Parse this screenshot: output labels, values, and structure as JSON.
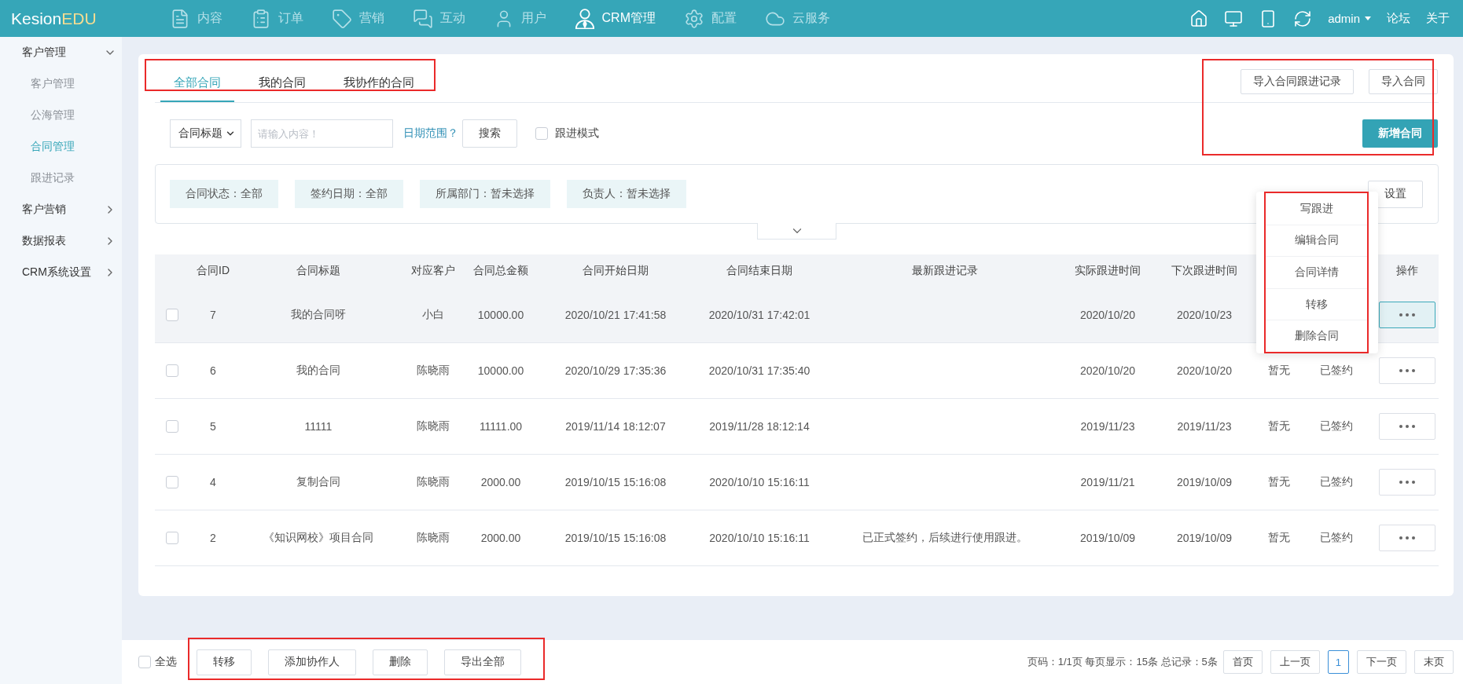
{
  "header": {
    "logo": {
      "brand": "Kesion",
      "accent": "EDU"
    },
    "nav": [
      {
        "label": "内容",
        "selected": false
      },
      {
        "label": "订单",
        "selected": false
      },
      {
        "label": "营销",
        "selected": false
      },
      {
        "label": "互动",
        "selected": false
      },
      {
        "label": "用户",
        "selected": false
      },
      {
        "label": "CRM管理",
        "selected": true
      },
      {
        "label": "配置",
        "selected": false
      },
      {
        "label": "云服务",
        "selected": false
      }
    ],
    "user": "admin",
    "links": [
      "论坛",
      "关于"
    ]
  },
  "sidebar": {
    "items": [
      {
        "label": "客户管理",
        "expanded": true,
        "children": [
          {
            "label": "客户管理",
            "selected": false
          },
          {
            "label": "公海管理",
            "selected": false
          },
          {
            "label": "合同管理",
            "selected": true
          },
          {
            "label": "跟进记录",
            "selected": false
          }
        ]
      },
      {
        "label": "客户营销",
        "expanded": false
      },
      {
        "label": "数据报表",
        "expanded": false
      },
      {
        "label": "CRM系统设置",
        "expanded": false
      }
    ]
  },
  "tab_bar": {
    "annotated": true,
    "tabs": [
      {
        "label": "全部合同",
        "selected": true
      },
      {
        "label": "我的合同",
        "selected": false
      },
      {
        "label": "我协作的合同",
        "selected": false
      }
    ]
  },
  "actions": {
    "annotated": true,
    "secondary": [
      "导入合同跟进记录",
      "导入合同"
    ],
    "primary": "新增合同"
  },
  "search": {
    "field": "合同标题",
    "placeholder": "请输入内容！",
    "date_range": "日期范围？",
    "button": "搜索",
    "follow_mode": {
      "label": "跟进模式",
      "checked": false
    }
  },
  "filters": {
    "chips": [
      "合同状态：全部",
      "签约日期：全部",
      "所属部门：暂未选择",
      "负责人：暂未选择"
    ],
    "settings": "设置",
    "expanded": false
  },
  "table": {
    "columns": [
      "合同ID",
      "合同标题",
      "对应客户",
      "合同总金额",
      "合同开始日期",
      "合同结束日期",
      "最新跟进记录",
      "实际跟进时间",
      "下次跟进时间",
      null,
      null,
      "操作"
    ],
    "rows": [
      {
        "checked": false,
        "selected": true,
        "menu_open": true,
        "id": "7",
        "title": "我的合同呀",
        "customer": "小白",
        "amount": "10000.00",
        "start": "2020/10/21 17:41:58",
        "end": "2020/10/31 17:42:01",
        "actual": "2020/10/20",
        "next": "2020/10/23"
      },
      {
        "checked": false,
        "selected": false,
        "menu_open": false,
        "id": "6",
        "title": "我的合同",
        "customer": "陈晓雨",
        "amount": "10000.00",
        "start": "2020/10/29 17:35:36",
        "end": "2020/10/31 17:35:40",
        "actual": "2020/10/20",
        "next": "2020/10/20",
        "column_10": "暂无",
        "column_11": "已签约"
      },
      {
        "checked": false,
        "selected": false,
        "menu_open": false,
        "id": "5",
        "title": "11111",
        "customer": "陈晓雨",
        "amount": "11111.00",
        "start": "2019/11/14 18:12:07",
        "end": "2019/11/28 18:12:14",
        "actual": "2019/11/23",
        "next": "2019/11/23",
        "column_10": "暂无",
        "column_11": "已签约"
      },
      {
        "checked": false,
        "selected": false,
        "menu_open": false,
        "id": "4",
        "title": "复制合同",
        "customer": "陈晓雨",
        "amount": "2000.00",
        "start": "2019/10/15 15:16:08",
        "end": "2020/10/10 15:16:11",
        "actual": "2019/11/21",
        "next": "2019/10/09",
        "column_10": "暂无",
        "column_11": "已签约"
      },
      {
        "checked": false,
        "selected": false,
        "menu_open": false,
        "id": "2",
        "title": "《知识网校》项目合同",
        "customer": "陈晓雨",
        "amount": "2000.00",
        "start": "2019/10/15 15:16:08",
        "end": "2020/10/10 15:16:11",
        "latest": "已正式签约，后续进行使用跟进。",
        "actual": "2019/10/09",
        "next": "2019/10/09",
        "column_10": "暂无",
        "column_11": "已签约"
      }
    ],
    "row_menu": {
      "annotated": true,
      "items": [
        "写跟进",
        "编辑合同",
        "合同详情",
        "转移",
        "删除合同"
      ]
    }
  },
  "bulk_bar": {
    "select_all": {
      "label": "全选",
      "checked": false
    },
    "annotated": true,
    "buttons": [
      "转移",
      "添加协作人",
      "删除",
      "导出全部"
    ]
  },
  "pagination": {
    "summary": "页码：1/1页 每页显示：15条 总记录：5条",
    "pages": [
      {
        "label": "首页",
        "selected": false
      },
      {
        "label": "上一页",
        "selected": false
      },
      {
        "label": "1",
        "selected": true
      },
      {
        "label": "下一页",
        "selected": false
      },
      {
        "label": "末页",
        "selected": false
      }
    ]
  }
}
